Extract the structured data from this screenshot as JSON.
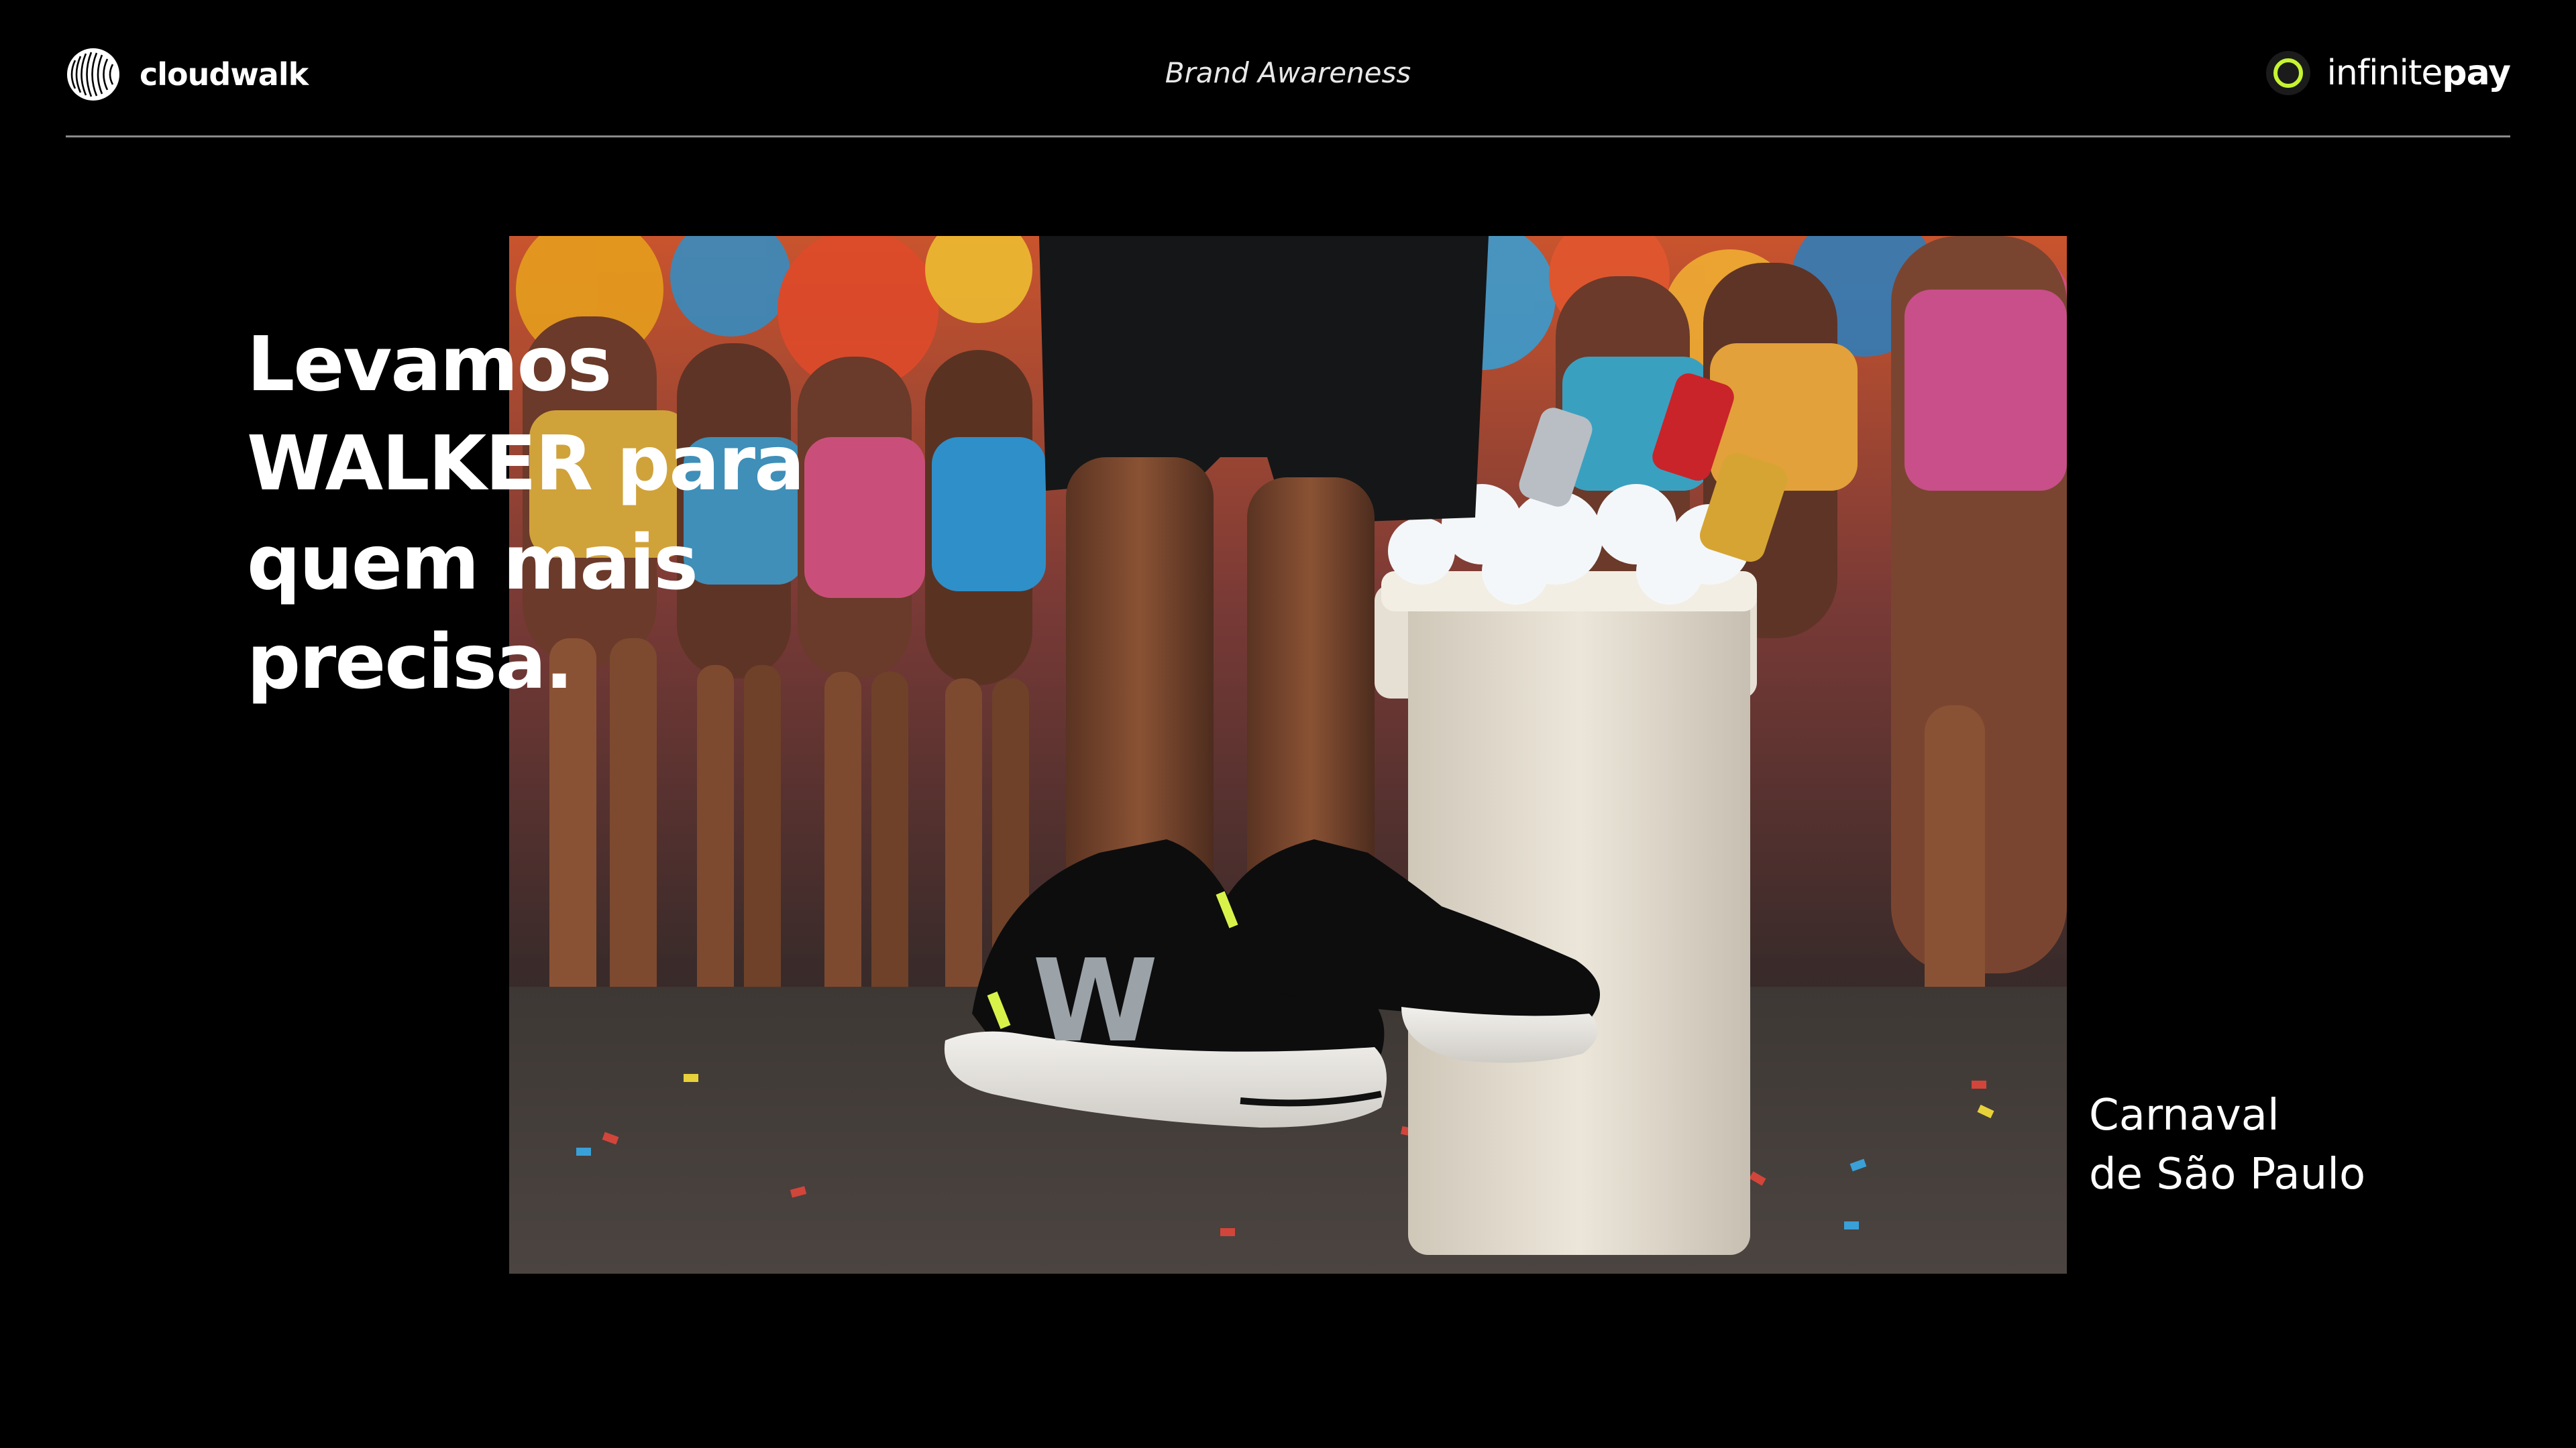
{
  "header": {
    "left_brand": {
      "name": "cloudwalk",
      "icon": "cloudwalk-logo-icon"
    },
    "center_title": "Brand Awareness",
    "right_brand": {
      "name_light": "infinite",
      "name_bold": "pay",
      "icon": "infinitepay-ring-icon",
      "accent_color": "#c6f432"
    }
  },
  "hero": {
    "headline_lines": [
      "Levamos",
      "WALKER para",
      "quem mais",
      "precisa."
    ],
    "image_subject": "walker-sneakers-carnival-photo",
    "sneaker_logo": "W"
  },
  "caption": {
    "line1": "Carnaval",
    "line2": "de São Paulo"
  },
  "colors": {
    "background": "#000000",
    "text": "#ffffff",
    "divider": "#8a8a8a",
    "accent": "#c6f432"
  }
}
